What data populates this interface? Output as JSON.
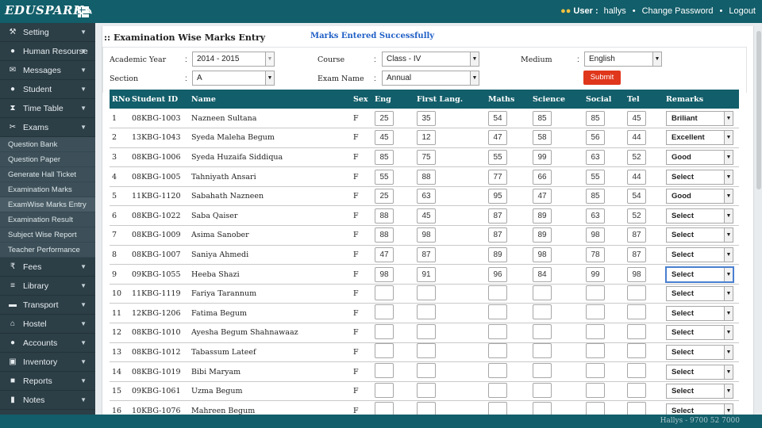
{
  "app": {
    "logo": "EDUSPARK",
    "user_label": "User :",
    "username": "hallys",
    "change_password": "Change Password",
    "logout": "Logout",
    "footer": "Hallys - 9700 52 7000"
  },
  "sidebar": {
    "items": [
      {
        "label": "Setting",
        "icon": "wrench-icon"
      },
      {
        "label": "Human Resourse",
        "icon": "person-icon"
      },
      {
        "label": "Messages",
        "icon": "envelope-icon"
      },
      {
        "label": "Student",
        "icon": "person-icon"
      },
      {
        "label": "Time Table",
        "icon": "hourglass-icon"
      },
      {
        "label": "Exams",
        "icon": "scissors-icon"
      }
    ],
    "exam_submenu": [
      "Question Bank",
      "Question Paper",
      "Generate Hall Ticket",
      "Examination Marks",
      "ExamWise Marks Entry",
      "Examination Result",
      "Subject Wise Report",
      "Teacher Performance"
    ],
    "items_after": [
      {
        "label": "Fees",
        "icon": "rupee-icon"
      },
      {
        "label": "Library",
        "icon": "book-icon"
      },
      {
        "label": "Transport",
        "icon": "car-icon"
      },
      {
        "label": "Hostel",
        "icon": "home-icon"
      },
      {
        "label": "Accounts",
        "icon": "users-icon"
      },
      {
        "label": "Inventory",
        "icon": "inventory-icon"
      },
      {
        "label": "Reports",
        "icon": "report-icon"
      },
      {
        "label": "Notes",
        "icon": "notes-icon"
      }
    ]
  },
  "page": {
    "title": ":: Examination Wise Marks Entry",
    "message": "Marks Entered Successfully"
  },
  "form": {
    "academic_year": {
      "label": "Academic Year",
      "value": "2014 - 2015"
    },
    "course": {
      "label": "Course",
      "value": "Class - IV"
    },
    "medium": {
      "label": "Medium",
      "value": "English"
    },
    "section": {
      "label": "Section",
      "value": "A"
    },
    "exam_name": {
      "label": "Exam Name",
      "value": "Annual"
    },
    "submit": "Submit",
    "colon": ":"
  },
  "table": {
    "headers": [
      "RNo",
      "Student ID",
      "Name",
      "Sex",
      "Eng",
      "First Lang.",
      "Maths",
      "Science",
      "Social",
      "Tel",
      "Remarks"
    ],
    "rows": [
      {
        "rno": "1",
        "id": "08KBG-1003",
        "name": "Nazneen Sultana",
        "sex": "F",
        "marks": [
          "25",
          "35",
          "54",
          "85",
          "85",
          "45"
        ],
        "remark": "Briliant"
      },
      {
        "rno": "2",
        "id": "13KBG-1043",
        "name": "Syeda Maleha Begum",
        "sex": "F",
        "marks": [
          "45",
          "12",
          "47",
          "58",
          "56",
          "44"
        ],
        "remark": "Excellent"
      },
      {
        "rno": "3",
        "id": "08KBG-1006",
        "name": "Syeda Huzaifa Siddiqua",
        "sex": "F",
        "marks": [
          "85",
          "75",
          "55",
          "99",
          "63",
          "52"
        ],
        "remark": "Good"
      },
      {
        "rno": "4",
        "id": "08KBG-1005",
        "name": "Tahniyath Ansari",
        "sex": "F",
        "marks": [
          "55",
          "88",
          "77",
          "66",
          "55",
          "44"
        ],
        "remark": "Select"
      },
      {
        "rno": "5",
        "id": "11KBG-1120",
        "name": "Sabahath Nazneen",
        "sex": "F",
        "marks": [
          "25",
          "63",
          "95",
          "47",
          "85",
          "54"
        ],
        "remark": "Good"
      },
      {
        "rno": "6",
        "id": "08KBG-1022",
        "name": "Saba Qaiser",
        "sex": "F",
        "marks": [
          "88",
          "45",
          "87",
          "89",
          "63",
          "52"
        ],
        "remark": "Select"
      },
      {
        "rno": "7",
        "id": "08KBG-1009",
        "name": "Asima Sanober",
        "sex": "F",
        "marks": [
          "88",
          "98",
          "87",
          "89",
          "98",
          "87"
        ],
        "remark": "Select"
      },
      {
        "rno": "8",
        "id": "08KBG-1007",
        "name": "Saniya Ahmedi",
        "sex": "F",
        "marks": [
          "47",
          "87",
          "89",
          "98",
          "78",
          "87"
        ],
        "remark": "Select"
      },
      {
        "rno": "9",
        "id": "09KBG-1055",
        "name": "Heeba Shazi",
        "sex": "F",
        "marks": [
          "98",
          "91",
          "96",
          "84",
          "99",
          "98"
        ],
        "remark": "Select"
      },
      {
        "rno": "10",
        "id": "11KBG-1119",
        "name": "Fariya Tarannum",
        "sex": "F",
        "marks": [
          "",
          "",
          "",
          "",
          "",
          ""
        ],
        "remark": "Select"
      },
      {
        "rno": "11",
        "id": "12KBG-1206",
        "name": "Fatima Begum",
        "sex": "F",
        "marks": [
          "",
          "",
          "",
          "",
          "",
          ""
        ],
        "remark": "Select"
      },
      {
        "rno": "12",
        "id": "08KBG-1010",
        "name": "Ayesha Begum Shahnawaaz",
        "sex": "F",
        "marks": [
          "",
          "",
          "",
          "",
          "",
          ""
        ],
        "remark": "Select"
      },
      {
        "rno": "13",
        "id": "08KBG-1012",
        "name": "Tabassum Lateef",
        "sex": "F",
        "marks": [
          "",
          "",
          "",
          "",
          "",
          ""
        ],
        "remark": "Select"
      },
      {
        "rno": "14",
        "id": "08KBG-1019",
        "name": "Bibi Maryam",
        "sex": "F",
        "marks": [
          "",
          "",
          "",
          "",
          "",
          ""
        ],
        "remark": "Select"
      },
      {
        "rno": "15",
        "id": "09KBG-1061",
        "name": "Uzma Begum",
        "sex": "F",
        "marks": [
          "",
          "",
          "",
          "",
          "",
          ""
        ],
        "remark": "Select"
      },
      {
        "rno": "16",
        "id": "10KBG-1076",
        "name": "Mahreen Begum",
        "sex": "F",
        "marks": [
          "",
          "",
          "",
          "",
          "",
          ""
        ],
        "remark": "Select"
      }
    ]
  }
}
